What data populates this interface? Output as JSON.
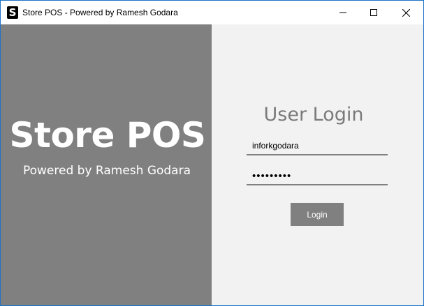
{
  "window": {
    "title": "Store POS - Powered by Ramesh Godara",
    "app_icon_letter": "S",
    "controls": {
      "minimize": "minimize-icon",
      "maximize": "maximize-icon",
      "close": "close-icon"
    }
  },
  "brand": {
    "title": "Store POS",
    "subtitle": "Powered by Ramesh Godara"
  },
  "login": {
    "heading": "User Login",
    "username_value": "inforkgodara",
    "password_value": "•••••••••",
    "button_label": "Login"
  },
  "colors": {
    "left_panel": "#808080",
    "right_panel": "#f2f2f2",
    "button": "#808080",
    "heading": "#7a7a7a"
  }
}
